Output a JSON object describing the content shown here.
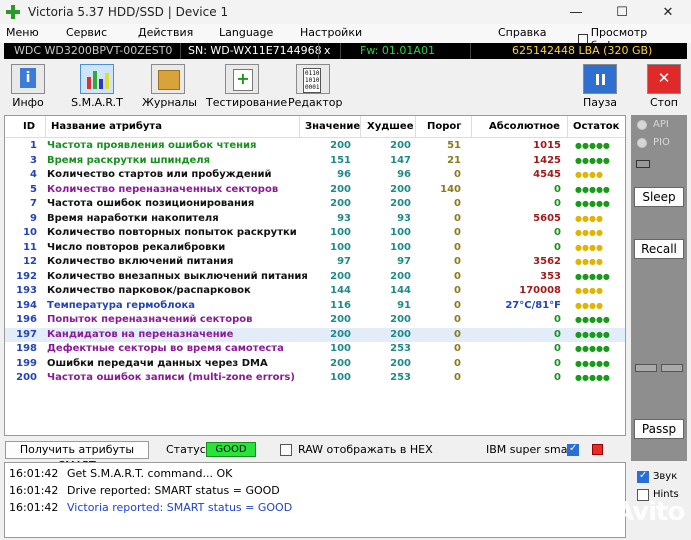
{
  "window": {
    "title": "Victoria 5.37 HDD/SSD | Device 1",
    "controls": [
      "minimize",
      "maximize",
      "close"
    ]
  },
  "menu": [
    "Меню",
    "Сервис",
    "Действия",
    "Language",
    "Настройки",
    "Справка",
    "Просмотр буфера"
  ],
  "device": {
    "model": "WDC WD3200BPVT-00ZEST0",
    "serial": "SN: WD-WX11E7144968",
    "x": "x",
    "firmware": "Fw: 01.01A01",
    "capacity": "625142448 LBA (320 GB)"
  },
  "toolbar": {
    "info": "Инфо",
    "smart": "S.M.A.R.T",
    "journals": "Журналы",
    "testing": "Тестирование",
    "editor": "Редактор",
    "pause": "Пауза",
    "stop": "Стоп"
  },
  "smart_table": {
    "headers": [
      "ID",
      "Название атрибута",
      "Значение",
      "Худшее",
      "Порог",
      "Абсолютное",
      "Остаток"
    ],
    "rows": [
      {
        "id": "1",
        "name": "Частота проявления ошибок чтения",
        "value": "200",
        "worst": "200",
        "threshold": "51",
        "raw": "1015",
        "remain": "●●●●●",
        "name_color": "green",
        "remain_color": "green"
      },
      {
        "id": "3",
        "name": "Время раскрутки шпинделя",
        "value": "151",
        "worst": "147",
        "threshold": "21",
        "raw": "1425",
        "remain": "●●●●●",
        "name_color": "green",
        "remain_color": "green"
      },
      {
        "id": "4",
        "name": "Количество стартов или пробуждений",
        "value": "96",
        "worst": "96",
        "threshold": "0",
        "raw": "4545",
        "remain": "●●●●",
        "name_color": "black",
        "remain_color": "yellow"
      },
      {
        "id": "5",
        "name": "Количество переназначенных секторов",
        "value": "200",
        "worst": "200",
        "threshold": "140",
        "raw": "0",
        "remain": "●●●●●",
        "name_color": "purple",
        "remain_color": "green"
      },
      {
        "id": "7",
        "name": "Частота ошибок позиционирования",
        "value": "200",
        "worst": "200",
        "threshold": "0",
        "raw": "0",
        "remain": "●●●●●",
        "name_color": "black",
        "remain_color": "green"
      },
      {
        "id": "9",
        "name": "Время наработки накопителя",
        "value": "93",
        "worst": "93",
        "threshold": "0",
        "raw": "5605",
        "remain": "●●●●",
        "name_color": "black",
        "remain_color": "yellow"
      },
      {
        "id": "10",
        "name": "Количество повторных попыток раскрутки",
        "value": "100",
        "worst": "100",
        "threshold": "0",
        "raw": "0",
        "remain": "●●●●",
        "name_color": "black",
        "remain_color": "yellow"
      },
      {
        "id": "11",
        "name": "Число повторов рекалибровки",
        "value": "100",
        "worst": "100",
        "threshold": "0",
        "raw": "0",
        "remain": "●●●●",
        "name_color": "black",
        "remain_color": "yellow"
      },
      {
        "id": "12",
        "name": "Количество включений питания",
        "value": "97",
        "worst": "97",
        "threshold": "0",
        "raw": "3562",
        "remain": "●●●●",
        "name_color": "black",
        "remain_color": "yellow"
      },
      {
        "id": "192",
        "name": "Количество внезапных выключений питания",
        "value": "200",
        "worst": "200",
        "threshold": "0",
        "raw": "353",
        "remain": "●●●●●",
        "name_color": "black",
        "remain_color": "green"
      },
      {
        "id": "193",
        "name": "Количество парковок/распарковок",
        "value": "144",
        "worst": "144",
        "threshold": "0",
        "raw": "170008",
        "remain": "●●●●",
        "name_color": "black",
        "remain_color": "yellow"
      },
      {
        "id": "194",
        "name": "Температура гермоблока",
        "value": "116",
        "worst": "91",
        "threshold": "0",
        "raw": "27°C/81°F",
        "remain": "●●●●",
        "name_color": "blue",
        "remain_color": "yellow"
      },
      {
        "id": "196",
        "name": "Попыток переназначений секторов",
        "value": "200",
        "worst": "200",
        "threshold": "0",
        "raw": "0",
        "remain": "●●●●●",
        "name_color": "purple",
        "remain_color": "green"
      },
      {
        "id": "197",
        "name": "Кандидатов на переназначение",
        "value": "200",
        "worst": "200",
        "threshold": "0",
        "raw": "0",
        "remain": "●●●●●",
        "name_color": "purple",
        "remain_color": "green",
        "selected": true
      },
      {
        "id": "198",
        "name": "Дефектные секторы во время самотеста",
        "value": "100",
        "worst": "253",
        "threshold": "0",
        "raw": "0",
        "remain": "●●●●●",
        "name_color": "purple",
        "remain_color": "green"
      },
      {
        "id": "199",
        "name": "Ошибки передачи данных через DMA",
        "value": "200",
        "worst": "200",
        "threshold": "0",
        "raw": "0",
        "remain": "●●●●●",
        "name_color": "black",
        "remain_color": "green"
      },
      {
        "id": "200",
        "name": "Частота ошибок записи (multi-zone errors)",
        "value": "100",
        "worst": "253",
        "threshold": "0",
        "raw": "0",
        "remain": "●●●●●",
        "name_color": "purple",
        "remain_color": "green"
      }
    ]
  },
  "status_bar": {
    "get_smart": "Получить атрибуты SMART",
    "status_label": "Статус:",
    "status_value": "GOOD",
    "raw_hex": "RAW отображать в HEX",
    "ibm_smart": "IBM super smart:",
    "raw_hex_checked": false,
    "ibm_checked": true
  },
  "side": {
    "api": "API",
    "pio": "PIO",
    "sleep": "Sleep",
    "recall": "Recall",
    "passp": "Passp"
  },
  "log": [
    {
      "time": "16:01:42",
      "message": "Get S.M.A.R.T. command... OK",
      "color": "black"
    },
    {
      "time": "16:01:42",
      "message": "Drive reported: SMART status = GOOD",
      "color": "black"
    },
    {
      "time": "16:01:42",
      "message": "Victoria reported: SMART status = GOOD",
      "color": "blue"
    }
  ],
  "options": {
    "sound": "Звук",
    "hints": "Hints",
    "sound_checked": true,
    "hints_checked": false
  },
  "watermark": "Avito",
  "colors": {
    "green": "#18911f",
    "purple": "#8a1b96",
    "blue": "#2244b8",
    "status_good": "#27e43a",
    "infobar_bg": "#000000"
  }
}
